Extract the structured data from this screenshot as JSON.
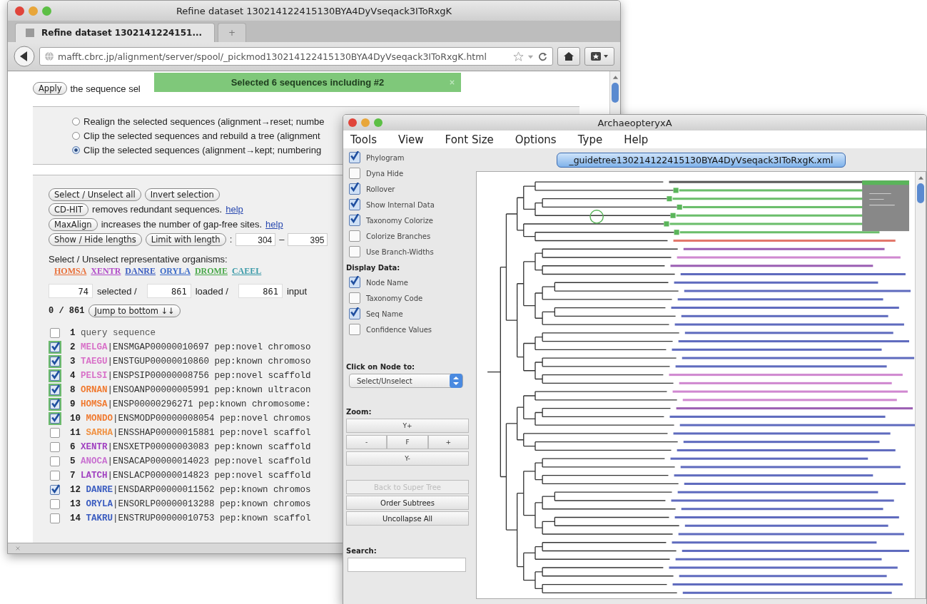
{
  "browser": {
    "title": "Refine dataset 130214122415130BYA4DyVseqack3IToRxgK",
    "tabs": [
      {
        "label": "Refine dataset 1302141224151...",
        "selected": true
      },
      {
        "label": "+",
        "selected": false
      }
    ],
    "url": "mafft.cbrc.jp/alignment/server/spool/_pickmod130214122415130BYA4DyVseqack3IToRxgK.html",
    "notification": "Selected 6 sequences including #2",
    "apply": {
      "button": "Apply",
      "text": "the sequence sel"
    },
    "radios": [
      {
        "label": "Realign the selected sequences (alignment→reset; numbe",
        "selected": false
      },
      {
        "label": "Clip the selected sequences and rebuild a tree (alignment",
        "selected": false
      },
      {
        "label": "Clip the selected sequences (alignment→kept; numbering",
        "selected": true
      }
    ],
    "selection_buttons": [
      "Select / Unselect all",
      "Invert selection"
    ],
    "tools": [
      {
        "button": "CD-HIT",
        "text": "removes redundant sequences.",
        "link": "help"
      },
      {
        "button": "MaxAlign",
        "text": "increases the number of gap-free sites.",
        "link": "help"
      }
    ],
    "lengths": {
      "toggle": "Show / Hide lengths",
      "limit": "Limit with length",
      "colon": ":",
      "min": "304",
      "dash": "–",
      "max": "395"
    },
    "organisms_label": "Select / Unselect representative organisms:",
    "organisms": [
      {
        "code": "HOMSA",
        "color": "#e8703a"
      },
      {
        "code": "XENTR",
        "color": "#b04ac8"
      },
      {
        "code": "DANRE",
        "color": "#3a5cc0"
      },
      {
        "code": "ORYLA",
        "color": "#3a6ac8"
      },
      {
        "code": "DROME",
        "color": "#4aa84a"
      },
      {
        "code": "CAEEL",
        "color": "#3a9aa8"
      }
    ],
    "counts": [
      {
        "value": "74",
        "label": "selected /"
      },
      {
        "value": "861",
        "label": "loaded /"
      },
      {
        "value": "861",
        "label": "input"
      }
    ],
    "position": "0 / 861",
    "jump": "Jump to bottom ↓↓",
    "sequences": [
      {
        "number": "1",
        "text": "query sequence",
        "checked": false,
        "highlighted": false
      },
      {
        "number": "2",
        "organism": "MELGA",
        "color": "#d870c8",
        "text": "|ENSMGAP00000010697 pep:novel chromoso",
        "checked": true,
        "highlighted": true
      },
      {
        "number": "3",
        "organism": "TAEGU",
        "color": "#d870c8",
        "text": "|ENSTGUP00000010860 pep:known chromoso",
        "checked": true,
        "highlighted": true
      },
      {
        "number": "4",
        "organism": "PELSI",
        "color": "#d870c8",
        "text": "|ENSPSIP00000008756 pep:novel scaffold",
        "checked": true,
        "highlighted": true
      },
      {
        "number": "8",
        "organism": "ORNAN",
        "color": "#f07a30",
        "text": "|ENSOANP00000005991 pep:known ultracon",
        "checked": true,
        "highlighted": true
      },
      {
        "number": "9",
        "organism": "HOMSA",
        "color": "#f07a30",
        "text": "|ENSP00000296271 pep:known chromosome:",
        "checked": true,
        "highlighted": true
      },
      {
        "number": "10",
        "organism": "MONDO",
        "color": "#f07a30",
        "text": "|ENSMODP00000008054 pep:novel chromos",
        "checked": true,
        "highlighted": true
      },
      {
        "number": "11",
        "organism": "SARHA",
        "color": "#f09040",
        "text": "|ENSSHAP00000015881 pep:novel scaffol",
        "checked": false,
        "highlighted": false
      },
      {
        "number": "6",
        "organism": "XENTR",
        "color": "#a040c0",
        "text": "|ENSXETP00000003083 pep:known scaffold",
        "checked": false,
        "highlighted": false
      },
      {
        "number": "5",
        "organism": "ANOCA",
        "color": "#c870d0",
        "text": "|ENSACAP00000014023 pep:novel scaffold",
        "checked": false,
        "highlighted": false
      },
      {
        "number": "7",
        "organism": "LATCH",
        "color": "#a040c0",
        "text": "|ENSLACP00000014823 pep:novel scaffold",
        "checked": false,
        "highlighted": false
      },
      {
        "number": "12",
        "organism": "DANRE",
        "color": "#3a5cc0",
        "text": "|ENSDARP00000011562 pep:known chromos",
        "checked": true,
        "highlighted": false
      },
      {
        "number": "13",
        "organism": "ORYLA",
        "color": "#3a5cc0",
        "text": "|ENSORLP00000013288 pep:known chromos",
        "checked": false,
        "highlighted": false
      },
      {
        "number": "14",
        "organism": "TAKRU",
        "color": "#3a5cc0",
        "text": "|ENSTRUP00000010753 pep:known scaffol",
        "checked": false,
        "highlighted": false
      }
    ]
  },
  "archaeopteryx": {
    "title": "ArchaeopteryxA",
    "menu": [
      "Tools",
      "View",
      "Font Size",
      "Options",
      "Type",
      "Help"
    ],
    "options": [
      {
        "label": "Phylogram",
        "checked": true
      },
      {
        "label": "Dyna Hide",
        "checked": false
      },
      {
        "label": "Rollover",
        "checked": true
      },
      {
        "label": "Show Internal Data",
        "checked": true
      },
      {
        "label": "Taxonomy Colorize",
        "checked": true
      },
      {
        "label": "Colorize Branches",
        "checked": false
      },
      {
        "label": "Use Branch-Widths",
        "checked": false
      }
    ],
    "display_heading": "Display Data:",
    "display_options": [
      {
        "label": "Node Name",
        "checked": true
      },
      {
        "label": "Taxonomy Code",
        "checked": false
      },
      {
        "label": "Seq Name",
        "checked": true
      },
      {
        "label": "Confidence Values",
        "checked": false
      }
    ],
    "click_heading": "Click on Node to:",
    "click_action": "Select/Unselect",
    "zoom_heading": "Zoom:",
    "zoom_buttons": [
      "Y+",
      "-",
      "F",
      "+",
      "Y-"
    ],
    "actions": [
      {
        "label": "Back to Super Tree",
        "disabled": true
      },
      {
        "label": "Order Subtrees",
        "disabled": false
      },
      {
        "label": "Uncollapse All",
        "disabled": false
      }
    ],
    "search_heading": "Search:",
    "tree_file": "_guidetree130214122415130BYA4DyVseqack3IToRxgK.xml"
  }
}
